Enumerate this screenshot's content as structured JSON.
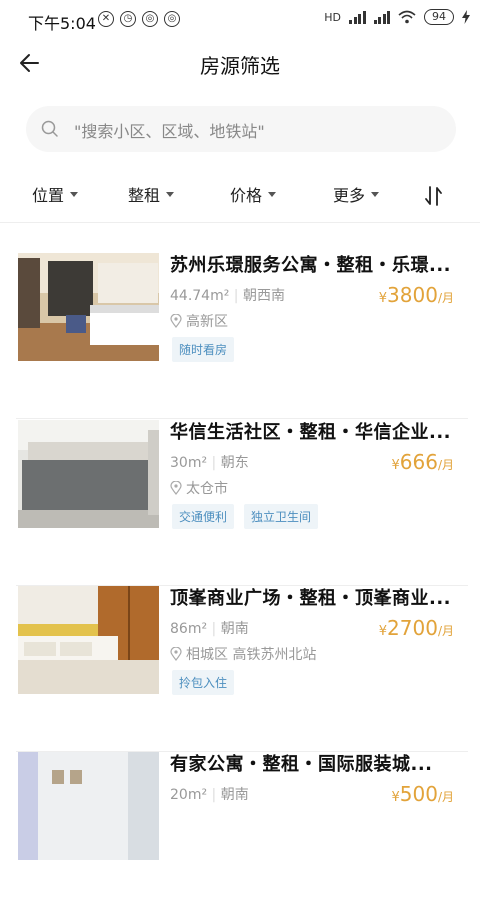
{
  "status_bar": {
    "time": "下午5:04",
    "battery": "94",
    "network": "HD"
  },
  "nav": {
    "title": "房源筛选"
  },
  "search": {
    "placeholder": "\"搜索小区、区域、地铁站\""
  },
  "filters": [
    {
      "label": "位置"
    },
    {
      "label": "整租"
    },
    {
      "label": "价格"
    },
    {
      "label": "更多"
    }
  ],
  "listings": [
    {
      "title": "苏州乐璟服务公寓・整租・乐璟...",
      "area": "44.74m²",
      "orientation": "朝西南",
      "location": "高新区",
      "price_symbol": "¥",
      "price": "3800",
      "unit": "/月",
      "tags": [
        "随时看房"
      ]
    },
    {
      "title": "华信生活社区・整租・华信企业...",
      "area": "30m²",
      "orientation": "朝东",
      "location": "太仓市",
      "price_symbol": "¥",
      "price": "666",
      "unit": "/月",
      "tags": [
        "交通便利",
        "独立卫生间"
      ]
    },
    {
      "title": "顶峯商业广场・整租・顶峯商业...",
      "area": "86m²",
      "orientation": "朝南",
      "location": "相城区 高铁苏州北站",
      "price_symbol": "¥",
      "price": "2700",
      "unit": "/月",
      "tags": [
        "拎包入住"
      ]
    },
    {
      "title": "有家公寓・整租・国际服装城...",
      "area": "20m²",
      "orientation": "朝南",
      "location": "",
      "price_symbol": "¥",
      "price": "500",
      "unit": "/月",
      "tags": []
    }
  ]
}
